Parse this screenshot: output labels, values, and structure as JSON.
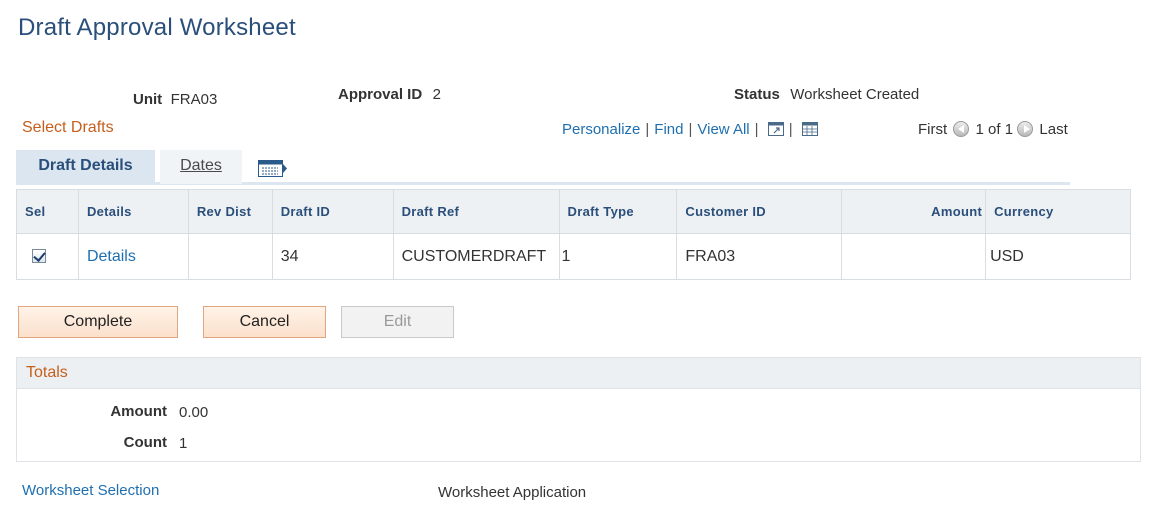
{
  "page": {
    "title": "Draft Approval Worksheet"
  },
  "header": {
    "unit_label": "Unit",
    "unit_value": "FRA03",
    "approval_id_label": "Approval ID",
    "approval_id_value": "2",
    "status_label": "Status",
    "status_value": "Worksheet Created"
  },
  "grid": {
    "title": "Select Drafts",
    "nav": {
      "personalize": "Personalize",
      "find": "Find",
      "view_all": "View All",
      "separator": "|",
      "first": "First",
      "pager": "1 of 1",
      "last": "Last",
      "icons": [
        "zoom-new-window-icon",
        "download-grid-icon",
        "previous-row-icon",
        "next-row-icon"
      ]
    },
    "tabs": [
      {
        "label": "Draft Details",
        "active": true
      },
      {
        "label": "Dates",
        "active": false
      }
    ],
    "show_all_tabs_icon": "show-all-columns-icon",
    "columns": [
      "Sel",
      "Details",
      "Rev Dist",
      "Draft ID",
      "Draft Ref",
      "Draft Type",
      "Customer ID",
      "Amount",
      "Currency"
    ],
    "rows": [
      {
        "sel_checked": true,
        "details": "Details",
        "rev_dist": "",
        "draft_id": "34",
        "draft_ref": "CUSTOMERDRAFT",
        "draft_type": "1",
        "customer_id": "FRA03",
        "amount": "",
        "currency": "USD"
      }
    ]
  },
  "buttons": {
    "complete": "Complete",
    "cancel": "Cancel",
    "edit": "Edit"
  },
  "totals": {
    "title": "Totals",
    "amount_label": "Amount",
    "amount_value": "0.00",
    "count_label": "Count",
    "count_value": "1"
  },
  "footer": {
    "worksheet_selection": "Worksheet Selection",
    "worksheet_application": "Worksheet Application"
  },
  "colors": {
    "title_blue": "#2a4f7a",
    "section_orange": "#c55f1c",
    "link_blue": "#1f6fb0",
    "tab_active_bg": "#dce6f0",
    "button_bg": "#fbe0cc",
    "button_border": "#e1a57f"
  }
}
